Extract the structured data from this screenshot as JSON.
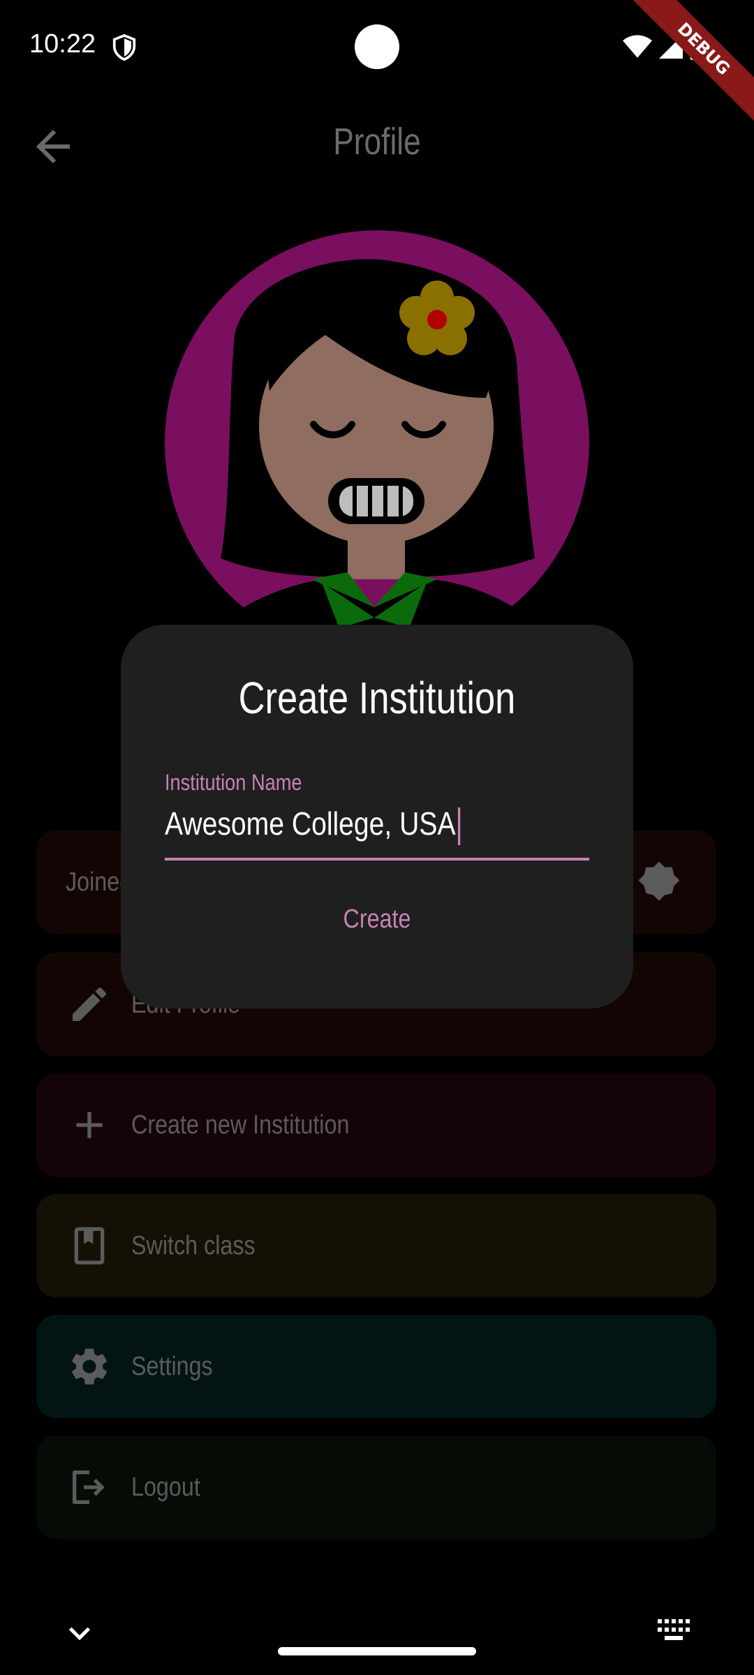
{
  "status_bar": {
    "time": "10:22",
    "debug_label": "DEBUG"
  },
  "app_bar": {
    "title": "Profile"
  },
  "menu": {
    "items": [
      {
        "label": "Joined",
        "icon": "verified-badge-icon",
        "bg": "#140505"
      },
      {
        "label": "Edit Profile",
        "icon": "pencil-icon",
        "bg": "#140505"
      },
      {
        "label": "Create new Institution",
        "icon": "plus-icon",
        "bg": "#140409"
      },
      {
        "label": "Switch class",
        "icon": "book-icon",
        "bg": "#141005"
      },
      {
        "label": "Settings",
        "icon": "gear-icon",
        "bg": "#031414"
      },
      {
        "label": "Logout",
        "icon": "logout-icon",
        "bg": "#050c05"
      }
    ]
  },
  "dialog": {
    "title": "Create Institution",
    "field_label": "Institution Name",
    "field_value": "Awesome College, USA",
    "action_label": "Create"
  },
  "colors": {
    "accent": "#c483b4",
    "dialog_bg": "#1f1f1f",
    "avatar_bg": "#7a0f5f"
  }
}
